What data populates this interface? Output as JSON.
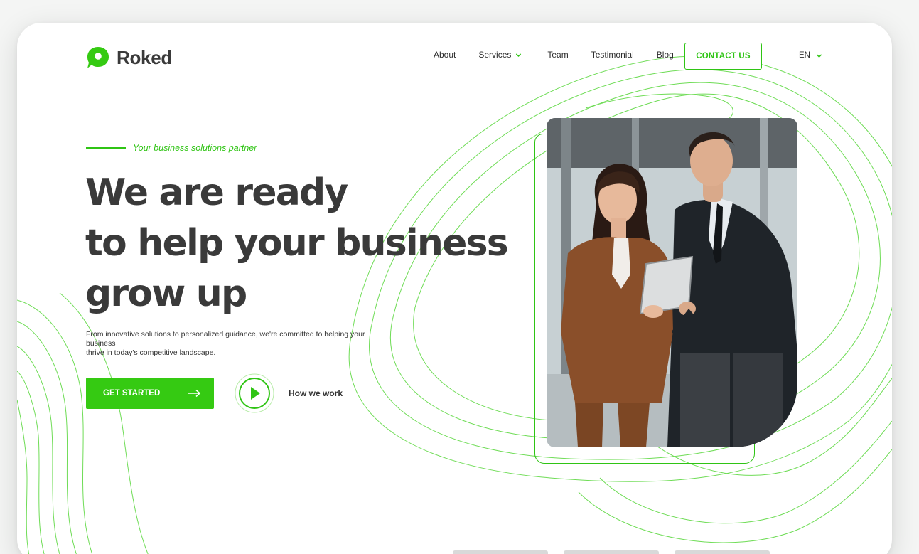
{
  "brand": {
    "name": "Roked",
    "accent": "#2fc414"
  },
  "nav": {
    "items": [
      {
        "label": "About"
      },
      {
        "label": "Services"
      },
      {
        "label": "Team"
      },
      {
        "label": "Testimonial"
      },
      {
        "label": "Blog"
      }
    ],
    "contact_label": "CONTACT US",
    "language": "EN"
  },
  "hero": {
    "tagline": "Your business solutions partner",
    "headline": [
      "We are ready",
      "to help your business",
      "grow up"
    ],
    "description_lines": [
      "From innovative solutions to personalized guidance, we're committed to helping your business",
      "thrive in today's competitive landscape."
    ],
    "cta_label": "GET STARTED",
    "video_label": "How we work"
  },
  "icons": {
    "logo": "location-pin-chat-icon",
    "services_dropdown": "chevron-down-icon",
    "lang_dropdown": "chevron-down-icon",
    "cta": "arrow-right-icon",
    "video": "play-icon"
  }
}
